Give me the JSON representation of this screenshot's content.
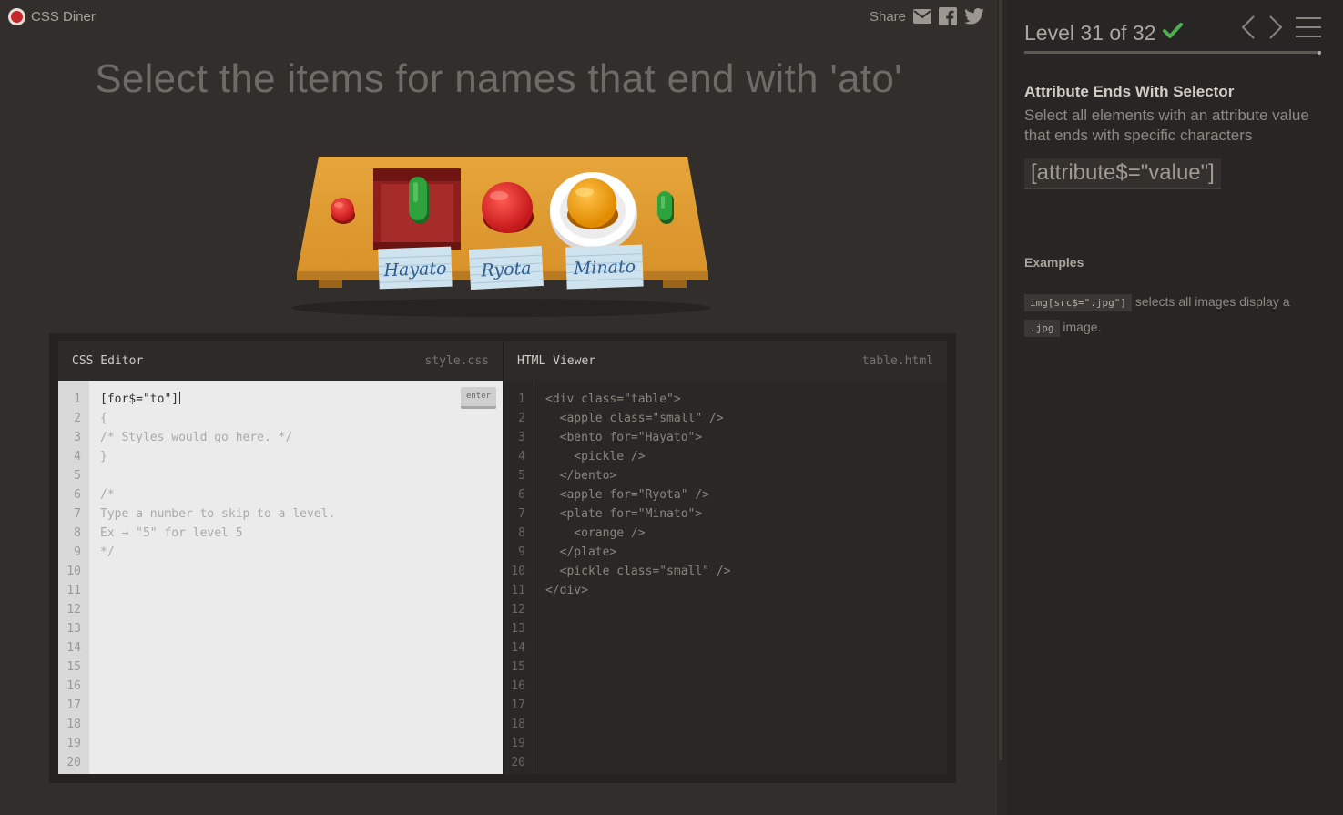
{
  "app": {
    "name": "CSS Diner"
  },
  "share": {
    "label": "Share",
    "icons": [
      "mail-icon",
      "facebook-icon",
      "twitter-icon"
    ]
  },
  "order": "Select the items for names that end with 'ato'",
  "table": {
    "labels": [
      "Hayato",
      "Ryota",
      "Minato"
    ]
  },
  "css_editor": {
    "title": "CSS Editor",
    "filename": "style.css",
    "input_value": "[for$=\"to\"]",
    "enter_label": "enter",
    "lines": [
      "{",
      "/* Styles would go here. */",
      "}",
      "",
      "/*",
      "Type a number to skip to a level.",
      "Ex → \"5\" for level 5",
      "*/"
    ],
    "line_numbers": [
      "1",
      "2",
      "3",
      "4",
      "5",
      "6",
      "7",
      "8",
      "9",
      "10",
      "11",
      "12",
      "13",
      "14",
      "15",
      "16",
      "17",
      "18",
      "19",
      "20"
    ]
  },
  "html_viewer": {
    "title": "HTML Viewer",
    "filename": "table.html",
    "lines": [
      "<div class=\"table\">",
      "  <apple class=\"small\" />",
      "  <bento for=\"Hayato\">",
      "    <pickle />",
      "  </bento>",
      "  <apple for=\"Ryota\" />",
      "  <plate for=\"Minato\">",
      "    <orange />",
      "  </plate>",
      "  <pickle class=\"small\" />",
      "</div>"
    ],
    "line_numbers": [
      "1",
      "2",
      "3",
      "4",
      "5",
      "6",
      "7",
      "8",
      "9",
      "10",
      "11",
      "12",
      "13",
      "14",
      "15",
      "16",
      "17",
      "18",
      "19",
      "20"
    ]
  },
  "sidebar": {
    "level_title": "Level 31 of 32",
    "completed": true,
    "selector_name": "Attribute Ends With Selector",
    "description": "Select all elements with an attribute value that ends with specific characters",
    "syntax": "[attribute$=\"value\"]",
    "examples_title": "Examples",
    "example_code": "img[src$=\".jpg\"]",
    "example_text": "selects all images display a",
    "example_code2": ".jpg",
    "example_text2": "image."
  },
  "colors": {
    "background": "#312e2b",
    "sidebar": "#282624",
    "check": "#4caf50",
    "table_wood": "#e0a036",
    "apple": "#d81e1e",
    "pickle": "#2e9a3a",
    "orange": "#f29b0e",
    "bento": "#9c2a27"
  }
}
